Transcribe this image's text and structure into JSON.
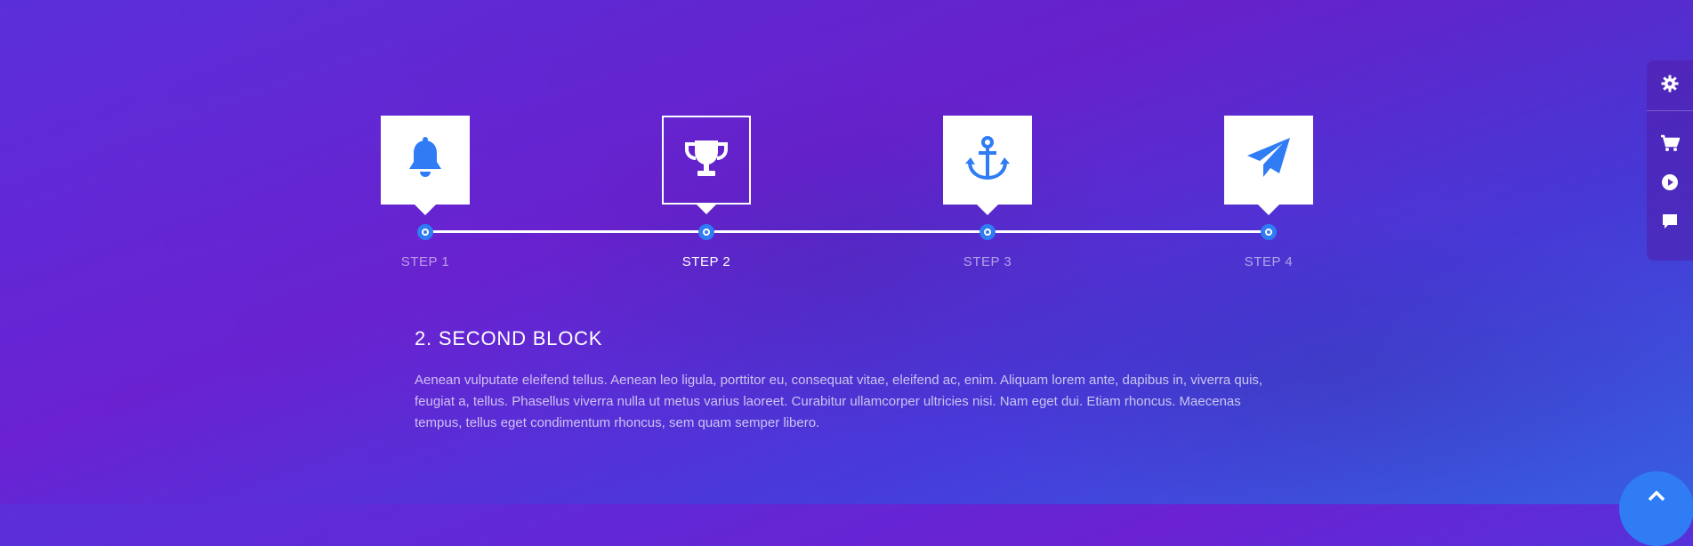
{
  "timeline": {
    "steps": [
      {
        "label": "STEP 1",
        "icon": "bell-icon",
        "active": false
      },
      {
        "label": "STEP 2",
        "icon": "trophy-icon",
        "active": true
      },
      {
        "label": "STEP 3",
        "icon": "anchor-icon",
        "active": false
      },
      {
        "label": "STEP 4",
        "icon": "paper-plane-icon",
        "active": false
      }
    ]
  },
  "content": {
    "title": "2. SECOND BLOCK",
    "body": "Aenean vulputate eleifend tellus. Aenean leo ligula, porttitor eu, consequat vitae, eleifend ac, enim. Aliquam lorem ante, dapibus in, viverra quis, feugiat a, tellus. Phasellus viverra nulla ut metus varius laoreet. Curabitur ullamcorper ultricies nisi. Nam eget dui. Etiam rhoncus. Maecenas tempus, tellus eget condimentum rhoncus, sem quam semper libero."
  },
  "side_panel": {
    "items": [
      "gear-icon",
      "cart-icon",
      "play-icon",
      "chat-icon"
    ]
  },
  "scroll_top": {
    "icon": "chevron-up-icon"
  },
  "colors": {
    "accent": "#2f7cf5",
    "white": "#ffffff"
  }
}
